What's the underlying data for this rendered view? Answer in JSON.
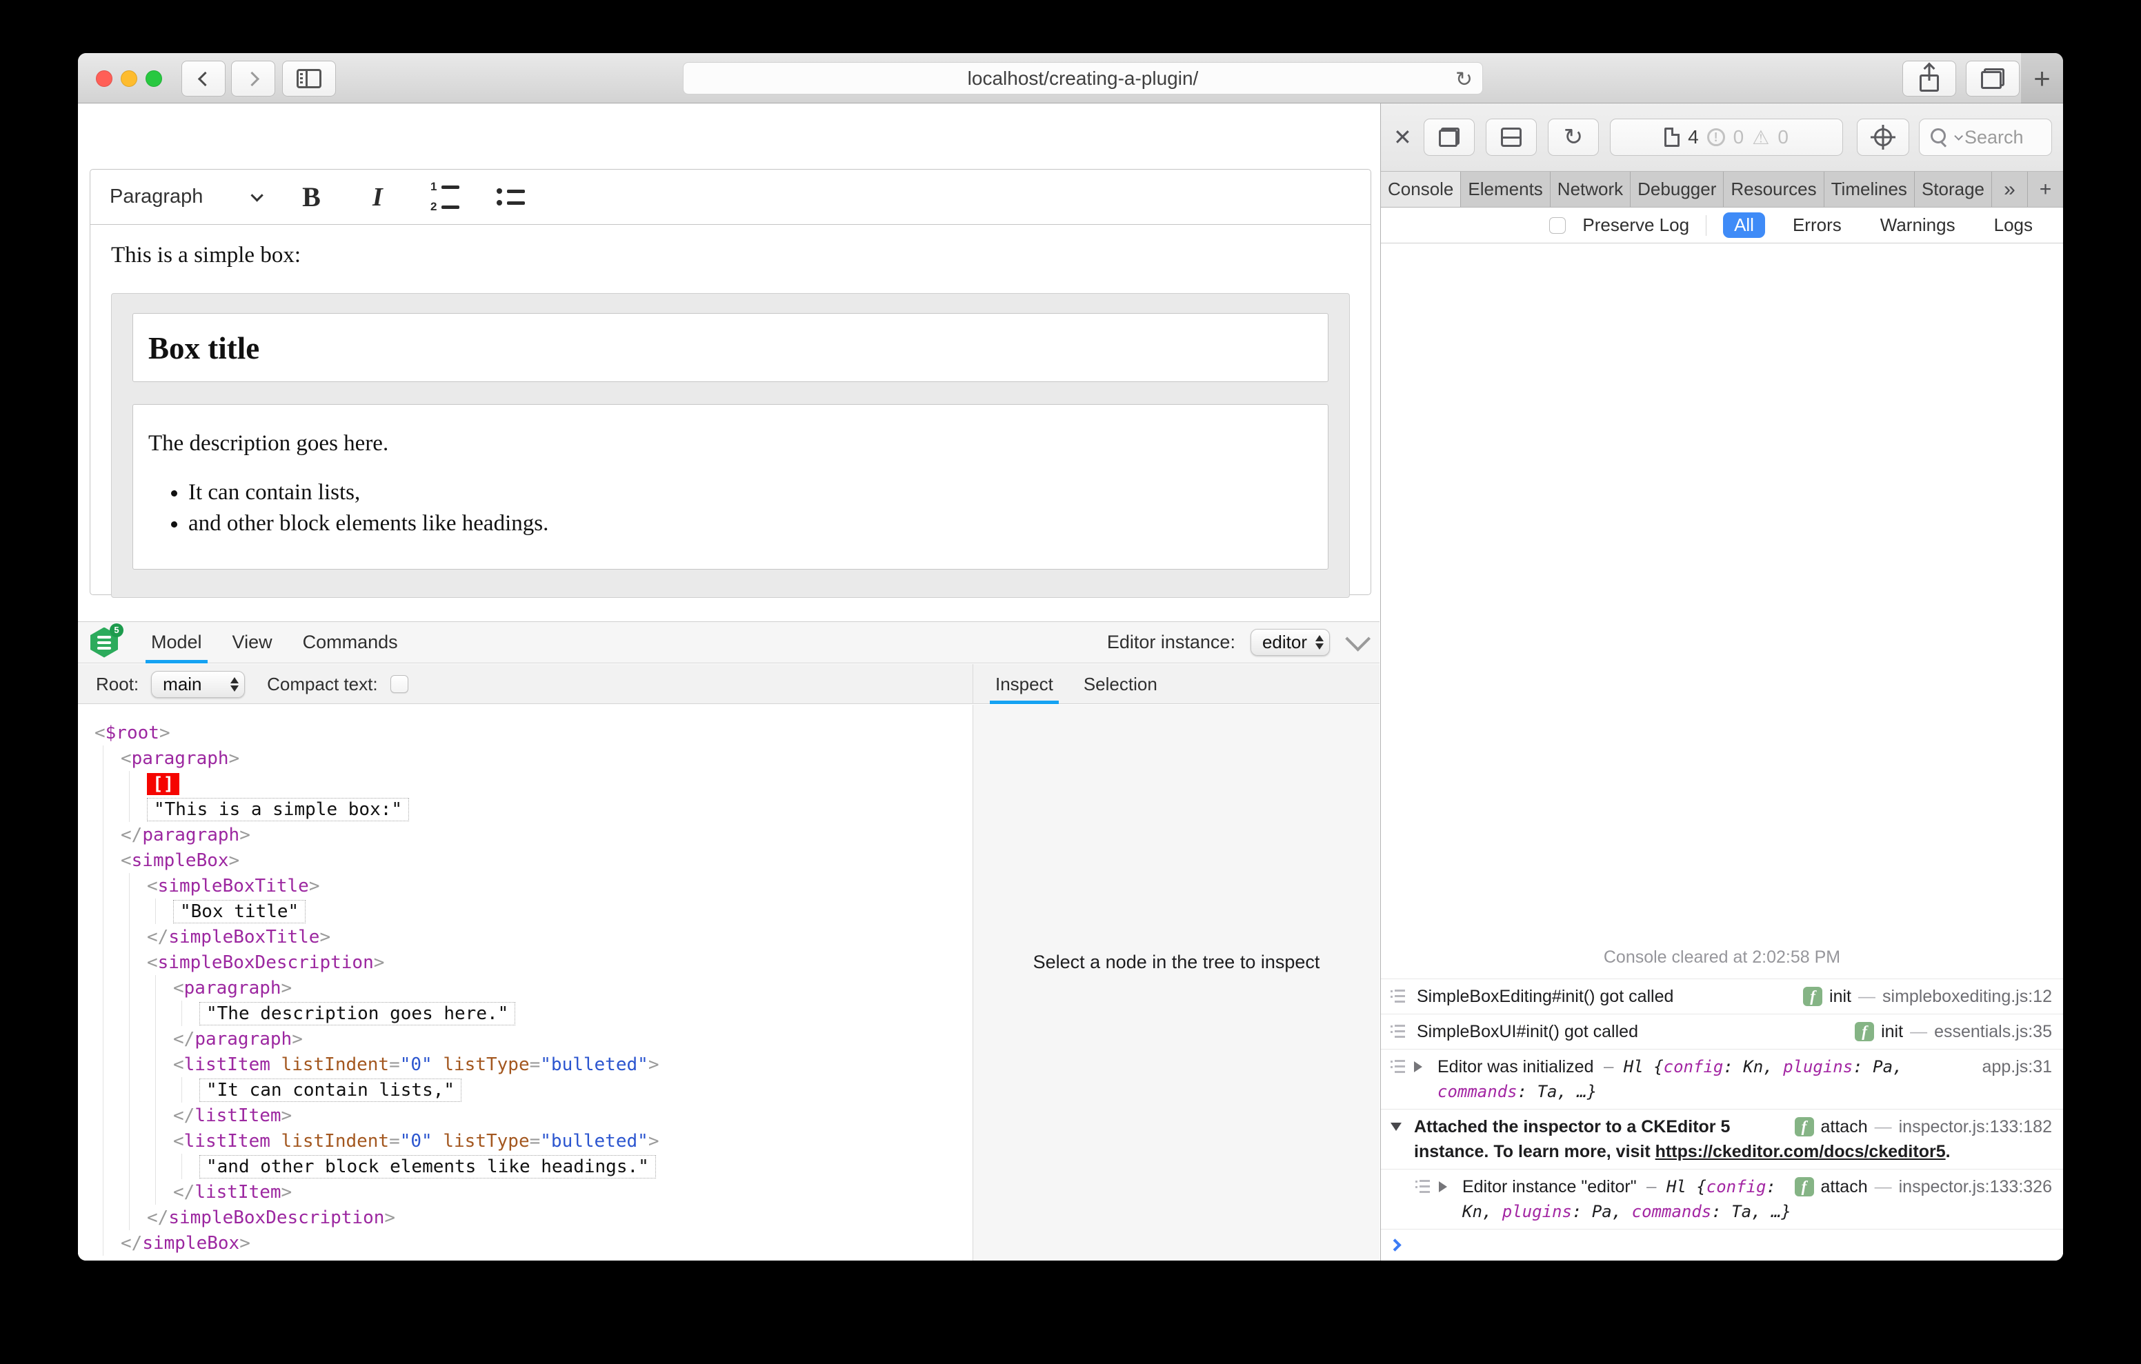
{
  "browser": {
    "url": "localhost/creating-a-plugin/"
  },
  "editor": {
    "toolbar": {
      "style_dropdown": "Paragraph",
      "bold_label": "B",
      "italic_label": "I"
    },
    "content": {
      "intro": "This is a simple box:",
      "box_title": "Box title",
      "description": "The description goes here.",
      "list_items": [
        "It can contain lists,",
        "and other block elements like headings."
      ]
    }
  },
  "ck_inspector": {
    "logo_badge": "5",
    "tabs": [
      "Model",
      "View",
      "Commands"
    ],
    "active_tab": "Model",
    "editor_instance_label": "Editor instance:",
    "editor_instance_value": "editor",
    "root_label": "Root:",
    "root_value": "main",
    "compact_text_label": "Compact text:",
    "side_tabs": [
      "Inspect",
      "Selection"
    ],
    "active_side_tab": "Inspect",
    "empty_panel_text": "Select a node in the tree to inspect",
    "tree": {
      "type": "element",
      "name": "$root",
      "children": [
        {
          "type": "element",
          "name": "paragraph",
          "children": [
            {
              "type": "selection",
              "marker": "[]"
            },
            {
              "type": "text",
              "value": "\"This is a simple box:\""
            }
          ]
        },
        {
          "type": "element",
          "name": "simpleBox",
          "children": [
            {
              "type": "element",
              "name": "simpleBoxTitle",
              "children": [
                {
                  "type": "text",
                  "value": "\"Box title\""
                }
              ]
            },
            {
              "type": "element",
              "name": "simpleBoxDescription",
              "children": [
                {
                  "type": "element",
                  "name": "paragraph",
                  "children": [
                    {
                      "type": "text",
                      "value": "\"The description goes here.\""
                    }
                  ]
                },
                {
                  "type": "element",
                  "name": "listItem",
                  "attrs": [
                    [
                      "listIndent",
                      "\"0\""
                    ],
                    [
                      "listType",
                      "\"bulleted\""
                    ]
                  ],
                  "children": [
                    {
                      "type": "text",
                      "value": "\"It can contain lists,\""
                    }
                  ]
                },
                {
                  "type": "element",
                  "name": "listItem",
                  "attrs": [
                    [
                      "listIndent",
                      "\"0\""
                    ],
                    [
                      "listType",
                      "\"bulleted\""
                    ]
                  ],
                  "children": [
                    {
                      "type": "text",
                      "value": "\"and other block elements like headings.\""
                    }
                  ]
                }
              ]
            }
          ]
        }
      ]
    }
  },
  "web_inspector": {
    "toolbar": {
      "resource_count": "4",
      "error_count": "0",
      "warning_count": "0",
      "search_placeholder": "Search"
    },
    "tabs": [
      "Console",
      "Elements",
      "Network",
      "Debugger",
      "Resources",
      "Timelines",
      "Storage"
    ],
    "active_tab": "Console",
    "more_tabs_glyph": "»",
    "new_tab_glyph": "+",
    "gear_glyph": "⚙",
    "filter": {
      "preserve_log_label": "Preserve Log",
      "options": [
        "All",
        "Errors",
        "Warnings",
        "Logs"
      ],
      "active_option": "All"
    },
    "console": {
      "cleared_text": "Console cleared at 2:02:58 PM",
      "messages": [
        {
          "icon": true,
          "text": "SimpleBoxEditing#init() got called",
          "badge_label": "init",
          "location": "simpleboxediting.js:12"
        },
        {
          "icon": true,
          "text": "SimpleBoxUI#init() got called",
          "badge_label": "init",
          "location": "essentials.js:35"
        },
        {
          "icon": true,
          "disclosure": "closed",
          "text": "Editor was initialized",
          "location": "app.js:31",
          "object": {
            "dash": "–",
            "class_name": "Hl",
            "pairs": [
              [
                "config",
                "Kn"
              ],
              [
                "plugins",
                "Pa"
              ],
              [
                "commands",
                "Ta"
              ]
            ],
            "ellipsis": ", …}"
          }
        },
        {
          "disclosure": "open",
          "bold": true,
          "text": "Attached the inspector to a CKEditor 5 instance. To learn more, visit ",
          "link": "https://ckeditor.com/docs/ckeditor5",
          "after_link": ".",
          "badge_label": "attach",
          "location": "inspector.js:133:182"
        },
        {
          "nested": true,
          "icon": true,
          "disclosure": "closed",
          "text": "Editor instance \"editor\"",
          "badge_label": "attach",
          "location": "inspector.js:133:326",
          "object": {
            "dash": "–",
            "class_name": "Hl",
            "pairs": [
              [
                "config",
                "Kn"
              ],
              [
                "plugins",
                "Pa"
              ],
              [
                "commands",
                "Ta"
              ]
            ],
            "ellipsis": ", …}"
          }
        }
      ]
    }
  }
}
